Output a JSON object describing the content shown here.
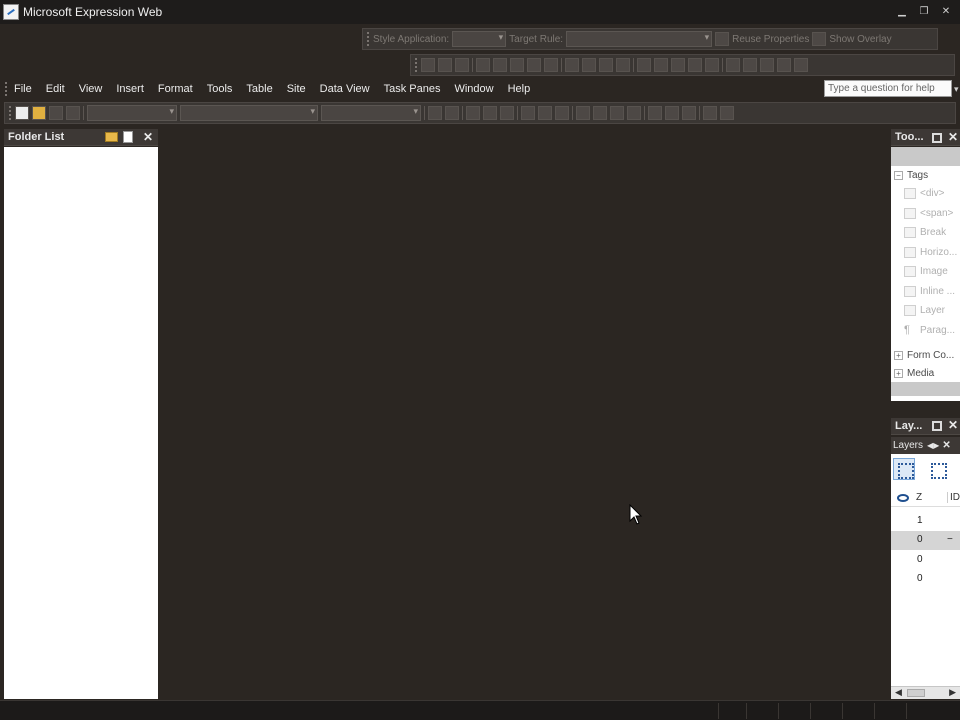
{
  "window": {
    "title": "Microsoft Expression Web"
  },
  "style_toolbar": {
    "style_application_label": "Style Application:",
    "target_rule_label": "Target Rule:",
    "reuse_properties_label": "Reuse Properties",
    "show_overlay_label": "Show Overlay"
  },
  "menu": {
    "items": [
      "File",
      "Edit",
      "View",
      "Insert",
      "Format",
      "Tools",
      "Table",
      "Site",
      "Data View",
      "Task Panes",
      "Window",
      "Help"
    ]
  },
  "help": {
    "placeholder": "Type a question for help"
  },
  "folder_list": {
    "title": "Folder List"
  },
  "toolbox": {
    "title": "Too...",
    "tags_group": "Tags",
    "tags": [
      "<div>",
      "<span>",
      "Break",
      "Horizo...",
      "Image",
      "Inline ...",
      "Layer",
      "Parag..."
    ],
    "form_controls_group": "Form Co...",
    "media_group": "Media"
  },
  "layers": {
    "title": "Lay...",
    "tab": "Layers",
    "col_z": "Z",
    "col_id": "ID",
    "rows": [
      "1",
      "0",
      "0",
      "0"
    ],
    "selected_row_marker": "−"
  },
  "colors": {
    "background": "#2b2622",
    "panel": "#ffffff",
    "chrome": "#3a3633"
  }
}
